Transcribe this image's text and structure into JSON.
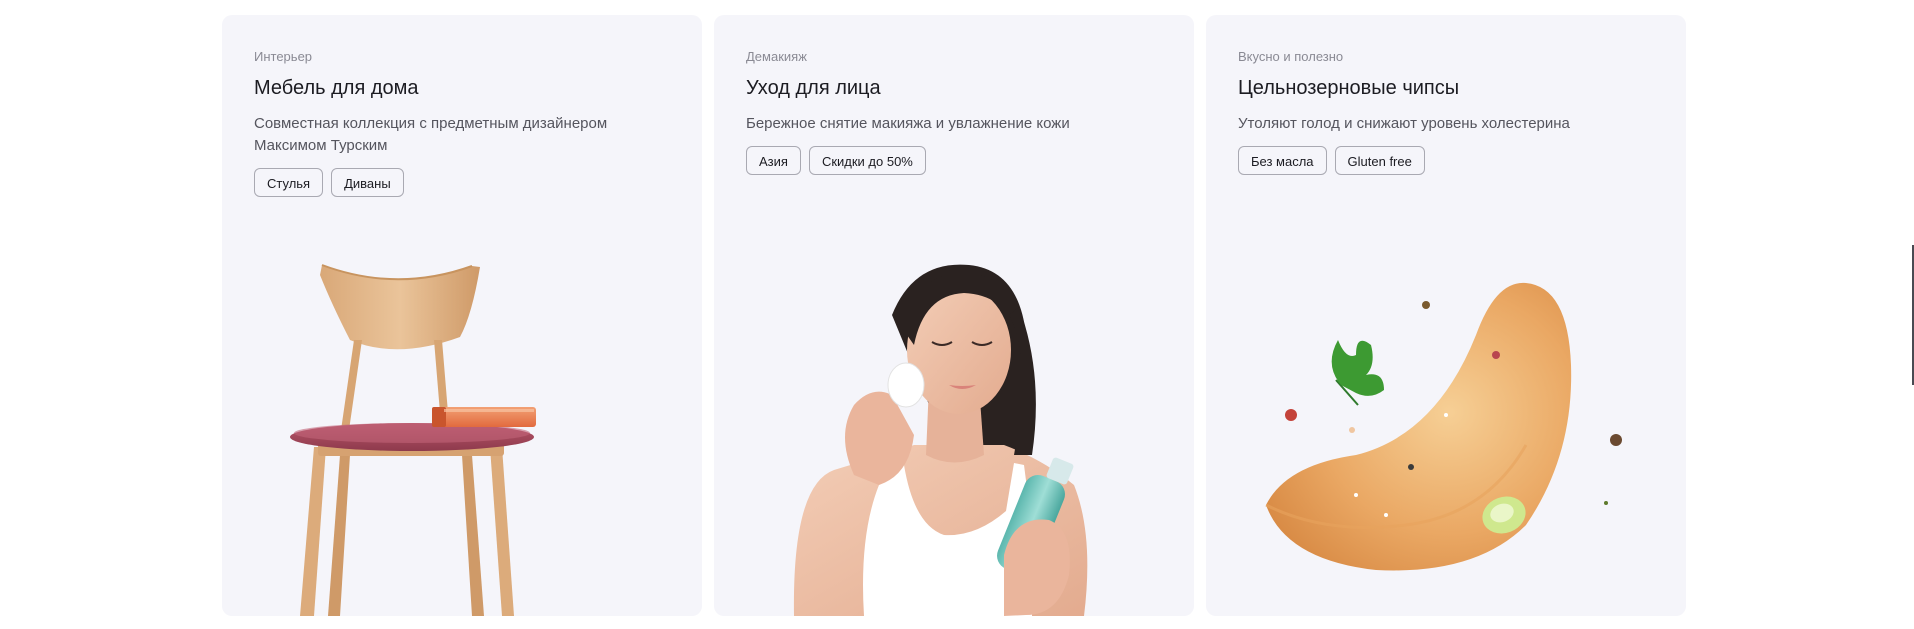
{
  "cards": [
    {
      "category": "Интерьер",
      "title": "Мебель для дома",
      "description": "Совместная коллекция с предметным дизайнером Максимом Турским",
      "tags": [
        "Стулья",
        "Диваны"
      ],
      "image": "chair-with-book-illustration"
    },
    {
      "category": "Демакияж",
      "title": "Уход для лица",
      "description": "Бережное снятие макияжа и увлажнение кожи",
      "tags": [
        "Азия",
        "Скидки до 50%"
      ],
      "image": "woman-removing-makeup-photo"
    },
    {
      "category": "Вкусно и полезно",
      "title": "Цельнозерновые чипсы",
      "description": "Утоляют голод и снижают уровень холестерина",
      "tags": [
        "Без масла",
        "Gluten free"
      ],
      "image": "potato-chip-with-parsley-illustration"
    }
  ],
  "colors": {
    "card_background": "#f5f5fa",
    "title": "#1c1c22",
    "category": "#8a8a94",
    "description": "#55555e",
    "tag_border": "#a9a9b2"
  }
}
